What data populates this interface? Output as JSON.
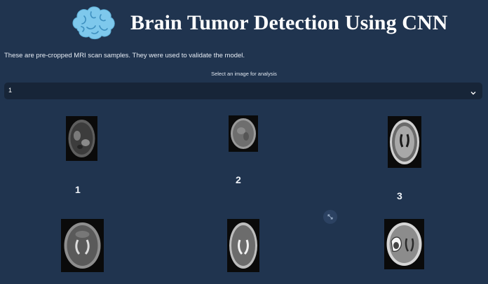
{
  "header": {
    "title": "Brain Tumor Detection Using CNN",
    "icon": "brain-icon"
  },
  "intro": {
    "text": "These are pre-cropped MRI scan samples. They were used to validate the model."
  },
  "select": {
    "label": "Select an image for analysis",
    "value": "1",
    "icon": "chevron-down-icon"
  },
  "gallery": {
    "captions": [
      "1",
      "2",
      "3"
    ],
    "expand_icon": "expand-icon"
  },
  "colors": {
    "background": "#20344f",
    "select_bg": "#172538",
    "brain_icon": "#7ec8ec"
  }
}
